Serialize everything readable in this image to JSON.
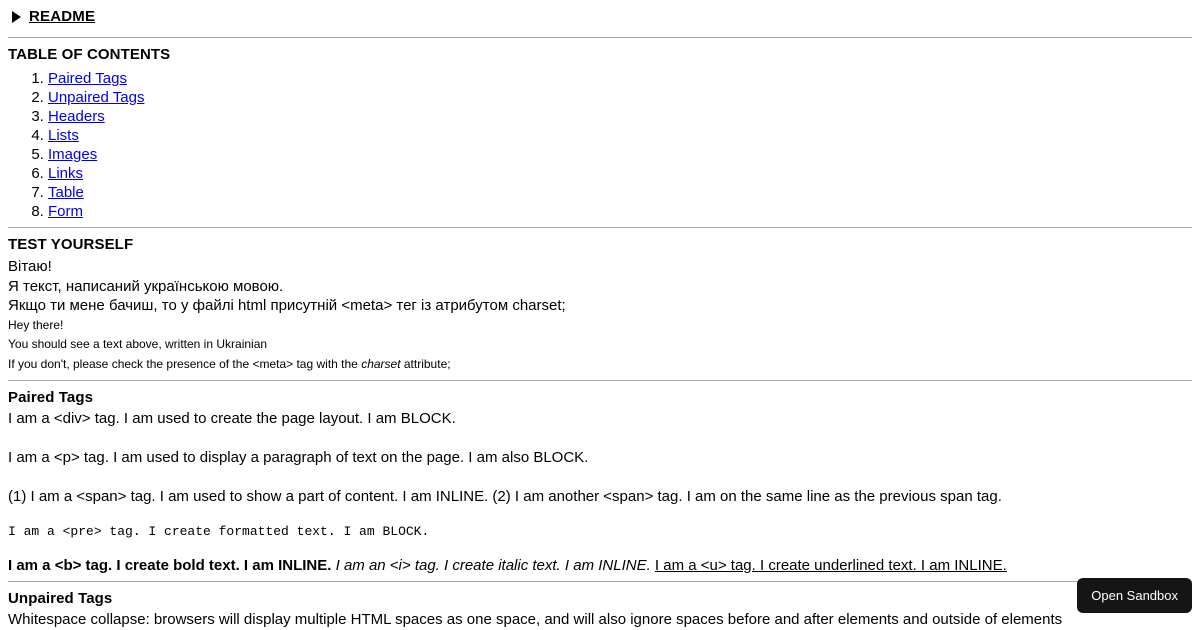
{
  "header": {
    "marker_icon": "disclosure-triangle-right-icon",
    "title": "README"
  },
  "toc": {
    "heading": "TABLE OF CONTENTS",
    "items": [
      {
        "label": "Paired Tags"
      },
      {
        "label": "Unpaired Tags"
      },
      {
        "label": "Headers"
      },
      {
        "label": "Lists"
      },
      {
        "label": "Images"
      },
      {
        "label": "Links"
      },
      {
        "label": "Table"
      },
      {
        "label": "Form"
      }
    ]
  },
  "test_yourself": {
    "heading": "TEST YOURSELF",
    "uk_lines": [
      "Вітаю!",
      "Я текст, написаний українською мовою.",
      "Якщо ти мене бачиш, то у файлі html присутній <meta> тег із атрибутом charset;"
    ],
    "en_lines": [
      "Hey there!",
      "You should see a text above, written in Ukrainian"
    ],
    "en_last_line": {
      "before": "If you don't, please check the presence of the <meta> tag with the ",
      "italic": "charset",
      "after": " attribute;"
    }
  },
  "paired_tags": {
    "heading": "Paired Tags",
    "div_line": "I am a <div> tag. I am used to create the page layout. I am BLOCK.",
    "p_line": "I am a <p> tag. I am used to display a paragraph of text on the page. I am also BLOCK.",
    "span_line": "(1) I am a <span> tag. I am used to show a part of content. I am INLINE. (2) I am another <span> tag. I am on the same line as the previous span tag.",
    "pre_line": "I am a <pre> tag. I create formatted text. I am BLOCK.",
    "bold_segment": "I am a <b> tag. I create bold text. I am INLINE.",
    "italic_segment": "I am an <i> tag. I create italic text. I am INLINE.",
    "underline_segment": "I am a <u> tag. I create underlined text. I am INLINE."
  },
  "unpaired_tags": {
    "heading": "Unpaired Tags",
    "whitespace_line": "Whitespace collapse: browsers will display multiple HTML spaces as one space, and will also ignore spaces before and after elements and outside of elements"
  },
  "overlay": {
    "open_sandbox_label": "Open Sandbox"
  },
  "colors": {
    "link": "#0000EE",
    "rule": "#A9A9A9",
    "button_bg": "#151515",
    "button_text": "#FFFFFF"
  }
}
